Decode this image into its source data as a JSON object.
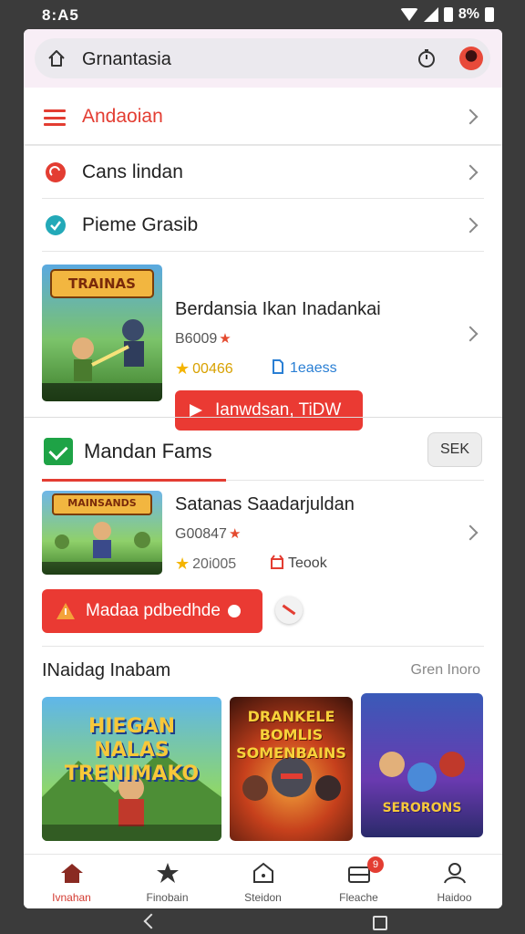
{
  "status_bar": {
    "time": "8:A5",
    "battery": "8%"
  },
  "top_bar": {
    "title": "Grnantasia"
  },
  "menu": {
    "label": "Andaoian"
  },
  "list": [
    {
      "label": "Cans lindan",
      "icon": "red-circle-icon"
    },
    {
      "label": "Pieme Grasib",
      "icon": "check-circle-icon"
    }
  ],
  "game1": {
    "title": "Berdansia Ikan Inadankai",
    "sub": "B6009",
    "rating": "00466",
    "tag": "1eaess",
    "button": "Ianwdsan, TiDW",
    "thumb_text": "TRAINAS"
  },
  "section": {
    "title": "Mandan Fams",
    "see_all": "SEK"
  },
  "game2": {
    "title": "Satanas Saadarjuldan",
    "sub": "G00847",
    "rating": "20i005",
    "tag": "Teook",
    "button": "Madaa pdbedhde",
    "thumb_text": "MAINSANDS"
  },
  "section2": {
    "title": "INaidag Inabam",
    "more": "Gren Inoro"
  },
  "tiles": [
    {
      "text": "HIEGAN NALAS TRENIMAKO"
    },
    {
      "text": "DRANKELE BOMLIS SOMENBAINS"
    },
    {
      "text": "SERORONS"
    }
  ],
  "bottom_nav": [
    {
      "label": "Ivnahan",
      "icon": "home-icon"
    },
    {
      "label": "Finobain",
      "icon": "star-icon"
    },
    {
      "label": "Steidon",
      "icon": "house-icon"
    },
    {
      "label": "Fleache",
      "icon": "inbox-icon",
      "badge": "9"
    },
    {
      "label": "Haidoo",
      "icon": "profile-icon"
    }
  ],
  "colors": {
    "accent": "#e33d32",
    "green": "#1ea346",
    "teal": "#23a9b8"
  }
}
